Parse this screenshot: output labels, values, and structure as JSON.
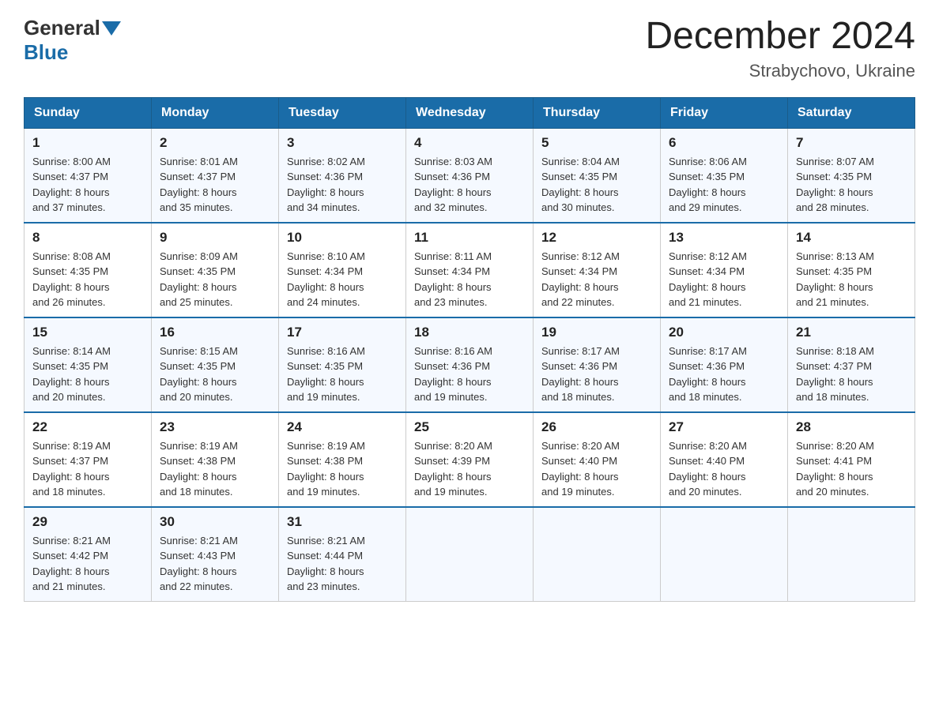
{
  "header": {
    "logo": {
      "general": "General",
      "blue": "Blue"
    },
    "month_title": "December 2024",
    "location": "Strabychovo, Ukraine"
  },
  "days_of_week": [
    "Sunday",
    "Monday",
    "Tuesday",
    "Wednesday",
    "Thursday",
    "Friday",
    "Saturday"
  ],
  "weeks": [
    [
      {
        "day": "1",
        "sunrise": "8:00 AM",
        "sunset": "4:37 PM",
        "daylight_hours": "8 hours",
        "daylight_minutes": "37 minutes"
      },
      {
        "day": "2",
        "sunrise": "8:01 AM",
        "sunset": "4:37 PM",
        "daylight_hours": "8 hours",
        "daylight_minutes": "35 minutes"
      },
      {
        "day": "3",
        "sunrise": "8:02 AM",
        "sunset": "4:36 PM",
        "daylight_hours": "8 hours",
        "daylight_minutes": "34 minutes"
      },
      {
        "day": "4",
        "sunrise": "8:03 AM",
        "sunset": "4:36 PM",
        "daylight_hours": "8 hours",
        "daylight_minutes": "32 minutes"
      },
      {
        "day": "5",
        "sunrise": "8:04 AM",
        "sunset": "4:35 PM",
        "daylight_hours": "8 hours",
        "daylight_minutes": "30 minutes"
      },
      {
        "day": "6",
        "sunrise": "8:06 AM",
        "sunset": "4:35 PM",
        "daylight_hours": "8 hours",
        "daylight_minutes": "29 minutes"
      },
      {
        "day": "7",
        "sunrise": "8:07 AM",
        "sunset": "4:35 PM",
        "daylight_hours": "8 hours",
        "daylight_minutes": "28 minutes"
      }
    ],
    [
      {
        "day": "8",
        "sunrise": "8:08 AM",
        "sunset": "4:35 PM",
        "daylight_hours": "8 hours",
        "daylight_minutes": "26 minutes"
      },
      {
        "day": "9",
        "sunrise": "8:09 AM",
        "sunset": "4:35 PM",
        "daylight_hours": "8 hours",
        "daylight_minutes": "25 minutes"
      },
      {
        "day": "10",
        "sunrise": "8:10 AM",
        "sunset": "4:34 PM",
        "daylight_hours": "8 hours",
        "daylight_minutes": "24 minutes"
      },
      {
        "day": "11",
        "sunrise": "8:11 AM",
        "sunset": "4:34 PM",
        "daylight_hours": "8 hours",
        "daylight_minutes": "23 minutes"
      },
      {
        "day": "12",
        "sunrise": "8:12 AM",
        "sunset": "4:34 PM",
        "daylight_hours": "8 hours",
        "daylight_minutes": "22 minutes"
      },
      {
        "day": "13",
        "sunrise": "8:12 AM",
        "sunset": "4:34 PM",
        "daylight_hours": "8 hours",
        "daylight_minutes": "21 minutes"
      },
      {
        "day": "14",
        "sunrise": "8:13 AM",
        "sunset": "4:35 PM",
        "daylight_hours": "8 hours",
        "daylight_minutes": "21 minutes"
      }
    ],
    [
      {
        "day": "15",
        "sunrise": "8:14 AM",
        "sunset": "4:35 PM",
        "daylight_hours": "8 hours",
        "daylight_minutes": "20 minutes"
      },
      {
        "day": "16",
        "sunrise": "8:15 AM",
        "sunset": "4:35 PM",
        "daylight_hours": "8 hours",
        "daylight_minutes": "20 minutes"
      },
      {
        "day": "17",
        "sunrise": "8:16 AM",
        "sunset": "4:35 PM",
        "daylight_hours": "8 hours",
        "daylight_minutes": "19 minutes"
      },
      {
        "day": "18",
        "sunrise": "8:16 AM",
        "sunset": "4:36 PM",
        "daylight_hours": "8 hours",
        "daylight_minutes": "19 minutes"
      },
      {
        "day": "19",
        "sunrise": "8:17 AM",
        "sunset": "4:36 PM",
        "daylight_hours": "8 hours",
        "daylight_minutes": "18 minutes"
      },
      {
        "day": "20",
        "sunrise": "8:17 AM",
        "sunset": "4:36 PM",
        "daylight_hours": "8 hours",
        "daylight_minutes": "18 minutes"
      },
      {
        "day": "21",
        "sunrise": "8:18 AM",
        "sunset": "4:37 PM",
        "daylight_hours": "8 hours",
        "daylight_minutes": "18 minutes"
      }
    ],
    [
      {
        "day": "22",
        "sunrise": "8:19 AM",
        "sunset": "4:37 PM",
        "daylight_hours": "8 hours",
        "daylight_minutes": "18 minutes"
      },
      {
        "day": "23",
        "sunrise": "8:19 AM",
        "sunset": "4:38 PM",
        "daylight_hours": "8 hours",
        "daylight_minutes": "18 minutes"
      },
      {
        "day": "24",
        "sunrise": "8:19 AM",
        "sunset": "4:38 PM",
        "daylight_hours": "8 hours",
        "daylight_minutes": "19 minutes"
      },
      {
        "day": "25",
        "sunrise": "8:20 AM",
        "sunset": "4:39 PM",
        "daylight_hours": "8 hours",
        "daylight_minutes": "19 minutes"
      },
      {
        "day": "26",
        "sunrise": "8:20 AM",
        "sunset": "4:40 PM",
        "daylight_hours": "8 hours",
        "daylight_minutes": "19 minutes"
      },
      {
        "day": "27",
        "sunrise": "8:20 AM",
        "sunset": "4:40 PM",
        "daylight_hours": "8 hours",
        "daylight_minutes": "20 minutes"
      },
      {
        "day": "28",
        "sunrise": "8:20 AM",
        "sunset": "4:41 PM",
        "daylight_hours": "8 hours",
        "daylight_minutes": "20 minutes"
      }
    ],
    [
      {
        "day": "29",
        "sunrise": "8:21 AM",
        "sunset": "4:42 PM",
        "daylight_hours": "8 hours",
        "daylight_minutes": "21 minutes"
      },
      {
        "day": "30",
        "sunrise": "8:21 AM",
        "sunset": "4:43 PM",
        "daylight_hours": "8 hours",
        "daylight_minutes": "22 minutes"
      },
      {
        "day": "31",
        "sunrise": "8:21 AM",
        "sunset": "4:44 PM",
        "daylight_hours": "8 hours",
        "daylight_minutes": "23 minutes"
      },
      null,
      null,
      null,
      null
    ]
  ]
}
